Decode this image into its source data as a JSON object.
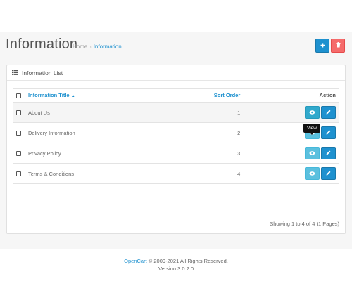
{
  "header": {
    "title": "Information",
    "breadcrumb": [
      {
        "label": "Home",
        "active": false
      },
      {
        "label": "Information",
        "active": true
      }
    ],
    "add_icon": "plus-icon",
    "delete_icon": "trash-icon",
    "add_color": "#1e91cf",
    "delete_color": "#f56b6b"
  },
  "panel": {
    "heading": "Information List",
    "heading_icon": "list-icon"
  },
  "table": {
    "columns": {
      "title": "Information Title",
      "sort_order": "Sort Order",
      "action": "Action"
    },
    "rows": [
      {
        "title": "About Us",
        "sort_order": "1"
      },
      {
        "title": "Delivery Information",
        "sort_order": "2"
      },
      {
        "title": "Privacy Policy",
        "sort_order": "3"
      },
      {
        "title": "Terms & Conditions",
        "sort_order": "4"
      }
    ],
    "view_icon": "eye-icon",
    "edit_icon": "pencil-icon",
    "sort_icon": "caret-up-icon"
  },
  "tooltip": "View",
  "pagination_text": "Showing 1 to 4 of 4 (1 Pages)",
  "footer": {
    "brand": "OpenCart",
    "copyright": "© 2009-2021 All Rights Reserved.",
    "version": "Version 3.0.2.0"
  }
}
